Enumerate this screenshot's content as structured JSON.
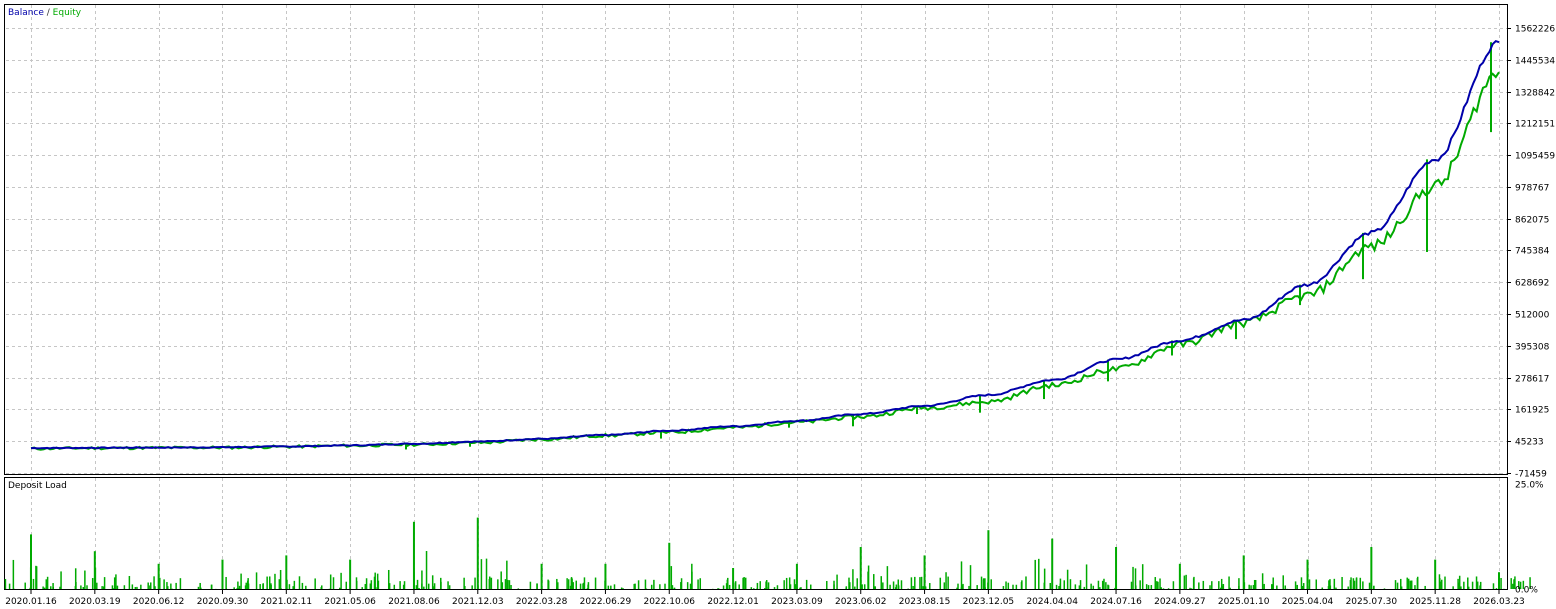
{
  "chart_data": [
    {
      "type": "line",
      "title": "",
      "legend": {
        "placement": "top-left",
        "entries": [
          "Balance",
          "Equity"
        ],
        "separator": " / "
      },
      "colors": {
        "balance": "#0000aa",
        "equity": "#00aa00",
        "grid": "#c6c6c6"
      },
      "grid": true,
      "x_tick_labels": [
        "2020.01.16",
        "2020.03.19",
        "2020.06.12",
        "2020.09.30",
        "2021.02.11",
        "2021.05.06",
        "2021.08.06",
        "2021.12.03",
        "2022.03.28",
        "2022.06.29",
        "2022.10.06",
        "2022.12.01",
        "2023.03.09",
        "2023.06.02",
        "2023.08.15",
        "2023.12.05",
        "2024.04.04",
        "2024.07.16",
        "2024.09.27",
        "2025.01.10",
        "2025.04.04",
        "2025.07.30",
        "2025.11.28",
        "2026.03.23"
      ],
      "y_tick_labels": [
        "1562226",
        "1445534",
        "1328842",
        "1212151",
        "1095459",
        "978767",
        "862075",
        "745384",
        "628692",
        "512000",
        "395308",
        "278617",
        "161925",
        "45233",
        "-71459"
      ],
      "ylim": [
        -71459,
        1562226
      ],
      "series": [
        {
          "name": "Balance",
          "x": [
            "2020.01.16",
            "2020.03.19",
            "2020.06.12",
            "2020.09.30",
            "2021.02.11",
            "2021.05.06",
            "2021.08.06",
            "2021.12.03",
            "2022.03.28",
            "2022.06.29",
            "2022.10.06",
            "2022.12.01",
            "2023.03.09",
            "2023.06.02",
            "2023.08.15",
            "2023.12.05",
            "2024.04.04",
            "2024.07.16",
            "2024.09.27",
            "2025.01.10",
            "2025.04.04",
            "2025.07.30",
            "2025.11.28",
            "2026.03.23"
          ],
          "values": [
            20000,
            21000,
            22000,
            23000,
            26000,
            30000,
            36000,
            44000,
            54000,
            68000,
            84000,
            100000,
            120000,
            145000,
            175000,
            215000,
            270000,
            345000,
            415000,
            490000,
            620000,
            810000,
            1080000,
            1510000
          ]
        },
        {
          "name": "Equity",
          "x": [
            "2020.01.16",
            "2020.03.19",
            "2020.06.12",
            "2020.09.30",
            "2021.02.11",
            "2021.05.06",
            "2021.08.06",
            "2021.12.03",
            "2022.03.28",
            "2022.06.29",
            "2022.10.06",
            "2022.12.01",
            "2023.03.09",
            "2023.06.02",
            "2023.08.15",
            "2023.12.05",
            "2024.04.04",
            "2024.07.16",
            "2024.09.27",
            "2025.01.10",
            "2025.04.04",
            "2025.07.30",
            "2025.11.28",
            "2026.03.23"
          ],
          "values": [
            18000,
            20000,
            21000,
            22000,
            25000,
            29000,
            33000,
            40000,
            52000,
            66000,
            78000,
            95000,
            115000,
            135000,
            168000,
            190000,
            250000,
            310000,
            400000,
            480000,
            580000,
            760000,
            980000,
            1400000
          ]
        }
      ],
      "drawdown_spikes": [
        {
          "x": "2021.08.06",
          "low": 15000
        },
        {
          "x": "2021.12.03",
          "low": 25000
        },
        {
          "x": "2022.10.06",
          "low": 55000
        },
        {
          "x": "2023.03.09",
          "low": 95000
        },
        {
          "x": "2023.06.02",
          "low": 100000
        },
        {
          "x": "2023.08.15",
          "low": 145000
        },
        {
          "x": "2023.12.05",
          "low": 150000
        },
        {
          "x": "2024.04.04",
          "low": 200000
        },
        {
          "x": "2024.07.16",
          "low": 265000
        },
        {
          "x": "2024.09.27",
          "low": 360000
        },
        {
          "x": "2025.01.10",
          "low": 420000
        },
        {
          "x": "2025.04.04",
          "low": 545000
        },
        {
          "x": "2025.07.30",
          "low": 640000
        },
        {
          "x": "2025.11.28",
          "low": 740000
        },
        {
          "x": "2026.03.23",
          "low": 1180000
        }
      ]
    },
    {
      "type": "bar",
      "title": "Deposit Load",
      "y_tick_labels": [
        "25.0%",
        "0.0%"
      ],
      "ylim": [
        0,
        25
      ],
      "colors": {
        "bars": "#00aa00"
      },
      "categories": [
        "2020.01.16",
        "2020.03.19",
        "2020.06.12",
        "2020.09.30",
        "2021.02.11",
        "2021.05.06",
        "2021.08.06",
        "2021.12.03",
        "2022.03.28",
        "2022.06.29",
        "2022.10.06",
        "2022.12.01",
        "2023.03.09",
        "2023.06.02",
        "2023.08.15",
        "2023.12.05",
        "2024.04.04",
        "2024.07.16",
        "2024.09.27",
        "2025.01.10",
        "2025.04.04",
        "2025.07.30",
        "2025.11.28",
        "2026.03.23"
      ],
      "values": [
        13,
        9,
        6,
        7,
        8,
        7,
        16,
        17,
        6,
        6,
        11,
        5,
        6,
        10,
        8,
        14,
        12,
        10,
        6,
        8,
        7,
        10,
        7,
        4
      ]
    }
  ]
}
